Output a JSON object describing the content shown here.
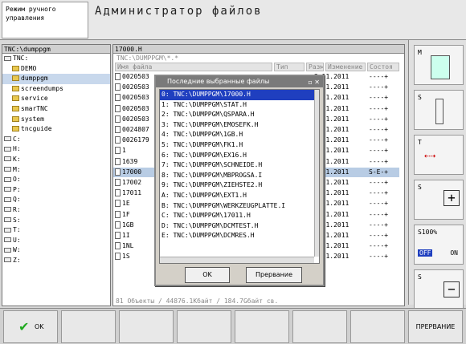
{
  "header": {
    "mode_line1": "Режим ручного",
    "mode_line2": "управления",
    "title": "Администратор файлов"
  },
  "tree": {
    "header": "TNC:\\dumppgm",
    "items": [
      {
        "label": "TNC:",
        "kind": "drive",
        "expanded": true
      },
      {
        "label": "DEMO",
        "kind": "folder"
      },
      {
        "label": "dumppgm",
        "kind": "folder",
        "selected": true
      },
      {
        "label": "screendumps",
        "kind": "folder"
      },
      {
        "label": "service",
        "kind": "folder"
      },
      {
        "label": "smarTNC",
        "kind": "folder"
      },
      {
        "label": "system",
        "kind": "folder"
      },
      {
        "label": "tncguide",
        "kind": "folder"
      },
      {
        "label": "C:",
        "kind": "drive"
      },
      {
        "label": "H:",
        "kind": "drive"
      },
      {
        "label": "K:",
        "kind": "drive"
      },
      {
        "label": "M:",
        "kind": "drive"
      },
      {
        "label": "O:",
        "kind": "drive"
      },
      {
        "label": "P:",
        "kind": "drive"
      },
      {
        "label": "Q:",
        "kind": "drive"
      },
      {
        "label": "R:",
        "kind": "drive"
      },
      {
        "label": "S:",
        "kind": "drive"
      },
      {
        "label": "T:",
        "kind": "drive"
      },
      {
        "label": "U:",
        "kind": "drive"
      },
      {
        "label": "W:",
        "kind": "drive"
      },
      {
        "label": "Z:",
        "kind": "drive"
      }
    ]
  },
  "files": {
    "path": "17000.H",
    "subpath": "TNC:\\DUMPPGM\\*.*",
    "columns": [
      "Имя файла",
      "Тип",
      "Разм.",
      "Изменение",
      "Состоя"
    ],
    "rows": [
      {
        "name": "0020503",
        "date": "3.11.2011",
        "status": "----+"
      },
      {
        "name": "0020503",
        "date": "3.11.2011",
        "status": "----+"
      },
      {
        "name": "0020503",
        "date": "3.11.2011",
        "status": "----+"
      },
      {
        "name": "0020503",
        "date": "3.11.2011",
        "status": "----+"
      },
      {
        "name": "0020503",
        "date": "3.11.2011",
        "status": "----+"
      },
      {
        "name": "0024807",
        "date": "3.11.2011",
        "status": "----+"
      },
      {
        "name": "0026179",
        "date": "4.11.2011",
        "status": "----+"
      },
      {
        "name": "1",
        "date": "4.11.2011",
        "status": "----+"
      },
      {
        "name": "1639",
        "date": "4.11.2011",
        "status": "----+"
      },
      {
        "name": "17000",
        "date": "4.11.2011",
        "status": "S-E-+",
        "selected": true
      },
      {
        "name": "17002",
        "date": "4.11.2011",
        "status": "----+"
      },
      {
        "name": "17011",
        "date": "4.11.2011",
        "status": "----+"
      },
      {
        "name": "1E",
        "date": "4.11.2011",
        "status": "----+"
      },
      {
        "name": "1F",
        "date": "4.11.2011",
        "status": "----+"
      },
      {
        "name": "1GB",
        "date": "4.11.2011",
        "status": "----+"
      },
      {
        "name": "1I",
        "date": "4.11.2011",
        "status": "----+"
      },
      {
        "name": "1NL",
        "date": "4.11.2011",
        "status": "----+"
      },
      {
        "name": "1S",
        "date": "4.11.2011",
        "status": "----+"
      }
    ],
    "status": "81 Объекты / 44876.1Кбайт / 184.7Gбайт св."
  },
  "dialog": {
    "title": "Последние выбранные файлы",
    "items": [
      "0: TNC:\\DUMPPGM\\17000.H",
      "1: TNC:\\DUMPPGM\\STAT.H",
      "2: TNC:\\DUMPPGM\\QSPARA.H",
      "3: TNC:\\DUMPPGM\\EMOSEFK.H",
      "4: TNC:\\DUMPPGM\\1GB.H",
      "5: TNC:\\DUMPPGM\\FK1.H",
      "6: TNC:\\DUMPPGM\\EX16.H",
      "7: TNC:\\DUMPPGM\\SCHNEIDE.H",
      "8: TNC:\\DUMPPGM\\MBPROGSA.I",
      "9: TNC:\\DUMPPGM\\ZIEHSTE2.H",
      "A: TNC:\\DUMPPGM\\EXT1.H",
      "B: TNC:\\DUMPPGM\\WERKZEUGPLATTE.I",
      "C: TNC:\\DUMPPGM\\17011.H",
      "D: TNC:\\DUMPPGM\\DCMTEST.H",
      "E: TNC:\\DUMPPGM\\DCMRES.H"
    ],
    "ok": "OK",
    "cancel": "Прервание"
  },
  "sidebar": {
    "m": "M",
    "s": "S",
    "t": "T",
    "s2": "S",
    "override": "S100%",
    "off": "OFF",
    "on": "ON",
    "s3": "S"
  },
  "softkeys": {
    "ok": "OK",
    "cancel": "ПРЕРВАНИЕ"
  }
}
